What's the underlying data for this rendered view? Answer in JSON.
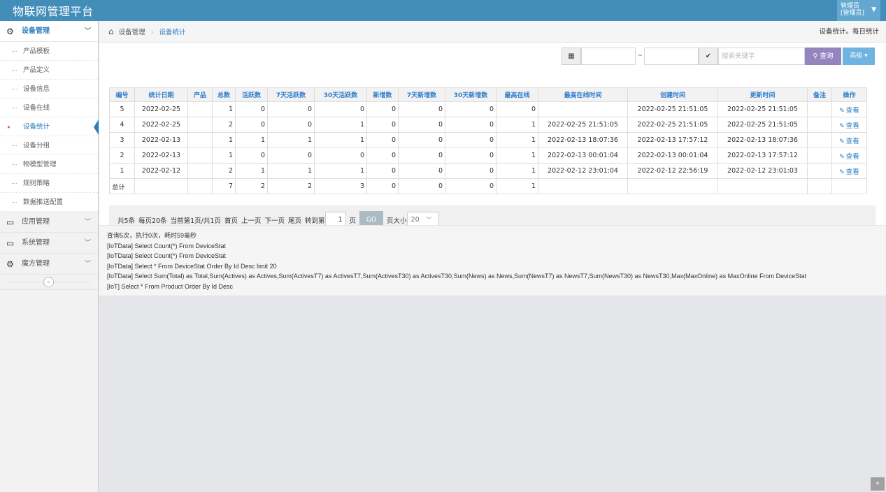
{
  "app": {
    "title": "物联网管理平台",
    "user_line1": "管理员",
    "user_line2": "[管理员]"
  },
  "sidebar": {
    "device_menu": "设备管理",
    "items": [
      "产品模板",
      "产品定义",
      "设备信息",
      "设备在线",
      "设备统计",
      "设备分组",
      "物模型管理",
      "规则策略",
      "数据推送配置"
    ],
    "app_menu": "应用管理",
    "system_menu": "系统管理",
    "magic_menu": "魔方管理",
    "collapse": "«"
  },
  "breadcrumb": {
    "parent": "设备管理",
    "current": "设备统计",
    "right_text": "设备统计。每日统计"
  },
  "toolbar": {
    "tilde": "~",
    "search_placeholder": "搜索关键字",
    "query_label": "查询",
    "more_label": "高级"
  },
  "table": {
    "headers": [
      "编号",
      "统计日期",
      "产品",
      "总数",
      "活跃数",
      "7天活跃数",
      "30天活跃数",
      "新增数",
      "7天新增数",
      "30天新增数",
      "最高在线",
      "最高在线时间",
      "创建时间",
      "更新时间",
      "备注",
      "操作"
    ],
    "rows": [
      [
        "5",
        "2022-02-25",
        "",
        "1",
        "0",
        "0",
        "0",
        "0",
        "0",
        "0",
        "0",
        "",
        "2022-02-25 21:51:05",
        "2022-02-25 21:51:05",
        "",
        "查看"
      ],
      [
        "4",
        "2022-02-25",
        "",
        "2",
        "0",
        "0",
        "1",
        "0",
        "0",
        "0",
        "1",
        "2022-02-25 21:51:05",
        "2022-02-25 21:51:05",
        "2022-02-25 21:51:05",
        "",
        "查看"
      ],
      [
        "3",
        "2022-02-13",
        "",
        "1",
        "1",
        "1",
        "1",
        "0",
        "0",
        "0",
        "1",
        "2022-02-13 18:07:36",
        "2022-02-13 17:57:12",
        "2022-02-13 18:07:36",
        "",
        "查看"
      ],
      [
        "2",
        "2022-02-13",
        "",
        "1",
        "0",
        "0",
        "0",
        "0",
        "0",
        "0",
        "1",
        "2022-02-13 00:01:04",
        "2022-02-13 00:01:04",
        "2022-02-13 17:57:12",
        "",
        "查看"
      ],
      [
        "1",
        "2022-02-12",
        "",
        "2",
        "1",
        "1",
        "1",
        "0",
        "0",
        "0",
        "1",
        "2022-02-12 23:01:04",
        "2022-02-12 22:56:19",
        "2022-02-12 23:01:03",
        "",
        "查看"
      ]
    ],
    "total_row": [
      "总计",
      "",
      "",
      "7",
      "2",
      "2",
      "3",
      "0",
      "0",
      "0",
      "1",
      "",
      "",
      "",
      "",
      ""
    ]
  },
  "pager": {
    "total": "共5条",
    "per_page": "每页20条",
    "current": "当前第1页/共1页",
    "first": "首页",
    "prev": "上一页",
    "next": "下一页",
    "last": "尾页",
    "goto": "转到第",
    "page_value": "1",
    "page_unit": "页",
    "go": "GO",
    "size_label": "页大小",
    "size_value": "20"
  },
  "log": {
    "lines": [
      "查询5次，执行0次，耗时59毫秒",
      "[IoTData] Select Count(*) From DeviceStat",
      "[IoTData] Select Count(*) From DeviceStat",
      "[IoTData] Select * From DeviceStat Order By Id Desc limit 20",
      "[IoTData] Select Sum(Total) as Total,Sum(Actives) as Actives,Sum(ActivesT7) as ActivesT7,Sum(ActivesT30) as ActivesT30,Sum(News) as News,Sum(NewsT7) as NewsT7,Sum(NewsT30) as NewsT30,Max(MaxOnline) as MaxOnline From DeviceStat",
      "[IoT] Select * From Product Order By Id Desc"
    ]
  }
}
